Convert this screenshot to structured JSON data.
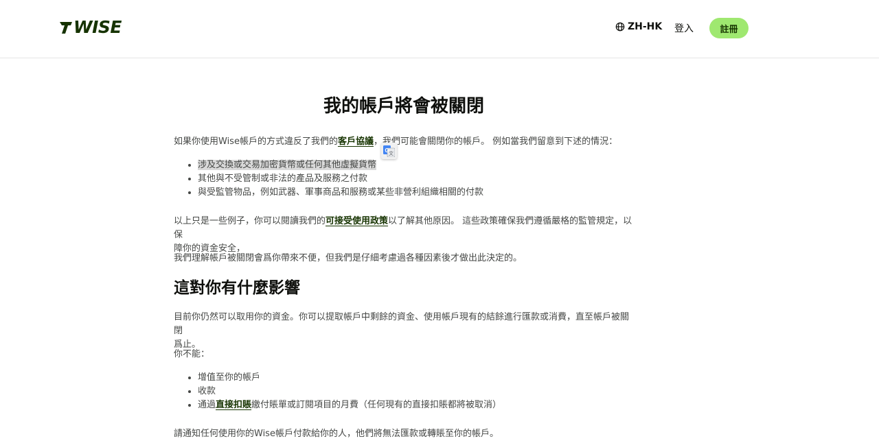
{
  "header": {
    "logo_text": "WISE",
    "language_label": "ZH-HK",
    "login_label": "登入",
    "signup_label": "註冊"
  },
  "main": {
    "title": "我的帳戶將會被關閉",
    "intro": {
      "before_link": "如果你使用Wise帳戶的方式違反了我們的",
      "link": "客戶協議",
      "after_link": "，我們可能會關閉你的帳戶。 例如當我們留意到下述的情況："
    },
    "reasons": [
      "涉及交換或交易加密貨幣或任何其他虛擬貨幣",
      "其他與不受管制或非法的產品及服務之付款",
      "與受監管物品，例如武器、軍事商品和服務或某些非營利組織相關的付款"
    ],
    "examples": {
      "before_link": "以上只是一些例子，你可以閱讀我們的",
      "link": "可接受使用政策",
      "after_link_line1": "以了解其他原因。 這些政策確保我們遵循嚴格的監管規定，以保",
      "line2": "障你的資金安全，"
    },
    "understand": "我們理解帳戶被關閉會爲你帶來不便，但我們是仔細考慮過各種因素後才做出此決定的。",
    "section_title": "這對你有什麼影響",
    "funds_line1": "目前你仍然可以取用你的資金。你可以提取帳戶中剩餘的資金、使用帳戶現有的結餘進行匯款或消費，直至帳戶被關閉",
    "funds_line2": "爲止。",
    "cannot_label": "你不能：",
    "cannot_items": {
      "item1": "增值至你的帳戶",
      "item2": "收款",
      "item3_before": "通過",
      "item3_link": "直接扣賬",
      "item3_after": "繳付賬單或訂閱項目的月費（任何現有的直接扣賬都將被取消）"
    },
    "notify": "請通知任何使用你的Wise帳戶付款給你的人，他們將無法匯款或轉賬至你的帳戶。"
  },
  "colors": {
    "brand_dark": "#163300",
    "brand_green": "#9fe870",
    "body_text": "#454745",
    "heading": "#0e0f0c"
  },
  "icons": {
    "language": "globe-icon",
    "translate": "google-translate-icon"
  }
}
